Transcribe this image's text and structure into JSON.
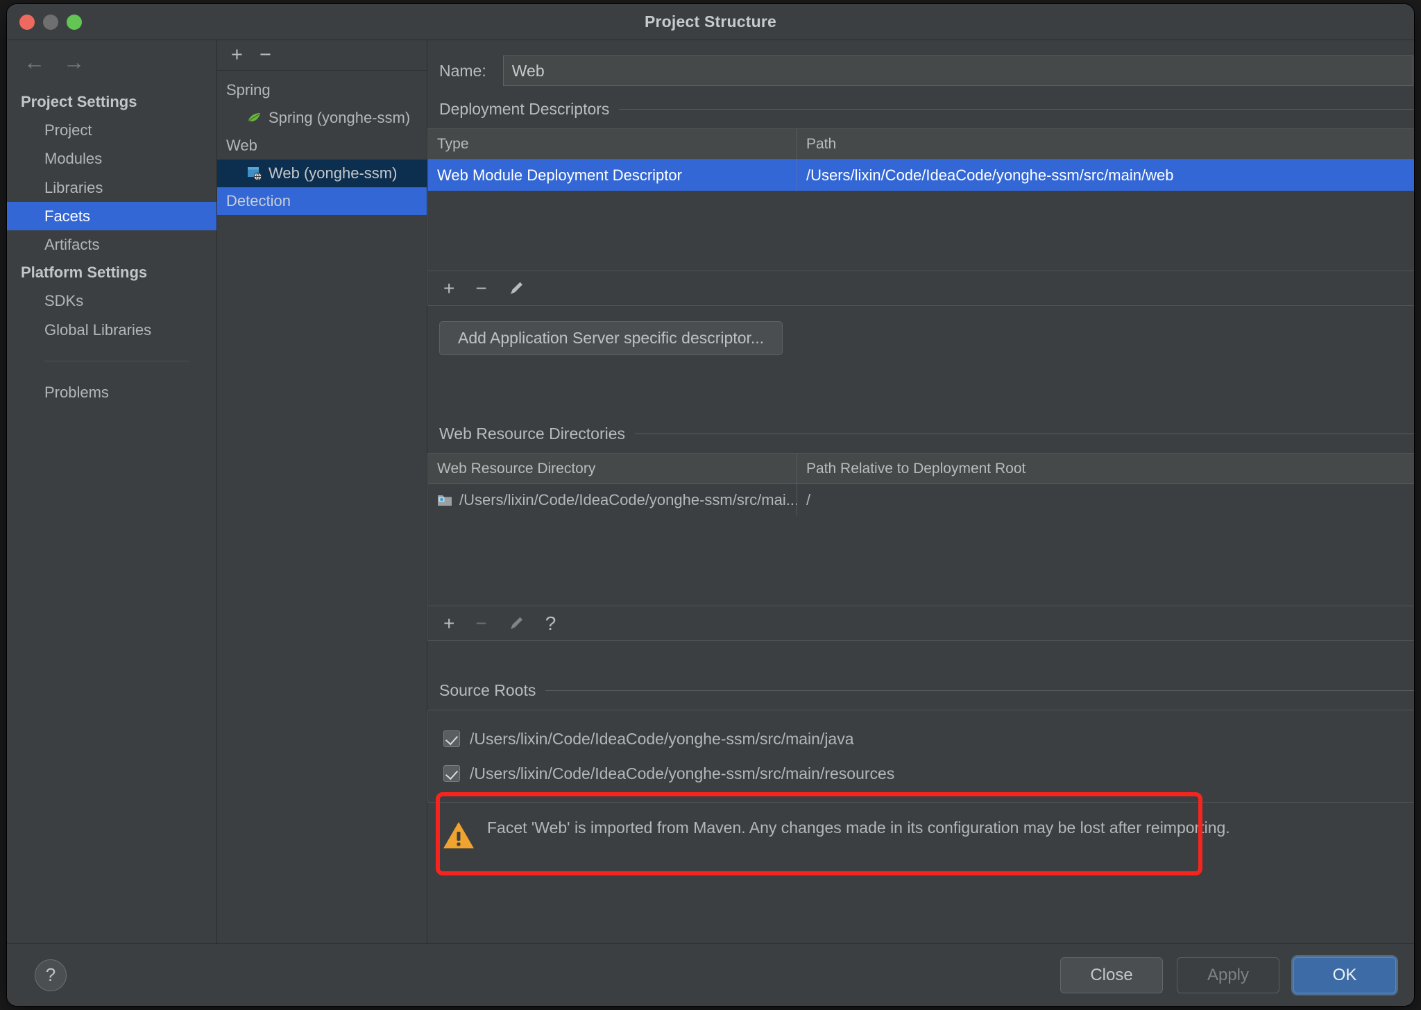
{
  "window": {
    "title": "Project Structure",
    "traffic_lights": [
      "close-red",
      "minimize-gray",
      "maximize-green"
    ]
  },
  "nav": {
    "back_icon": "←",
    "forward_icon": "→",
    "groups": [
      {
        "title": "Project Settings",
        "items": [
          {
            "label": "Project",
            "selected": false
          },
          {
            "label": "Modules",
            "selected": false
          },
          {
            "label": "Libraries",
            "selected": false
          },
          {
            "label": "Facets",
            "selected": true
          },
          {
            "label": "Artifacts",
            "selected": false
          }
        ]
      },
      {
        "title": "Platform Settings",
        "items": [
          {
            "label": "SDKs",
            "selected": false
          },
          {
            "label": "Global Libraries",
            "selected": false
          }
        ]
      }
    ],
    "problems_label": "Problems"
  },
  "tree": {
    "toolbar": {
      "add_icon": "+",
      "remove_icon": "−"
    },
    "rows": [
      {
        "label": "Spring",
        "kind": "group",
        "icon": null,
        "state": "none"
      },
      {
        "label": "Spring (yonghe-ssm)",
        "kind": "child",
        "icon": "spring-leaf-icon",
        "state": "none"
      },
      {
        "label": "Web",
        "kind": "group",
        "icon": null,
        "state": "none"
      },
      {
        "label": "Web (yonghe-ssm)",
        "kind": "child",
        "icon": "web-facet-icon",
        "state": "selected-inactive"
      },
      {
        "label": "Detection",
        "kind": "group",
        "icon": null,
        "state": "selected-active"
      }
    ]
  },
  "detail": {
    "name_label": "Name:",
    "name_value": "Web",
    "name_placeholder": "",
    "deployment": {
      "section_title": "Deployment Descriptors",
      "columns": [
        "Type",
        "Path"
      ],
      "rows": [
        {
          "type": "Web Module Deployment Descriptor",
          "path": "/Users/lixin/Code/IdeaCode/yonghe-ssm/src/main/web",
          "selected": true
        }
      ],
      "toolbar": {
        "add": "+",
        "remove": "−",
        "edit": "pencil-icon"
      },
      "add_server_descriptor_button": "Add Application Server specific descriptor..."
    },
    "web_resources": {
      "section_title": "Web Resource Directories",
      "columns": [
        "Web Resource Directory",
        "Path Relative to Deployment Root"
      ],
      "rows": [
        {
          "directory": "/Users/lixin/Code/IdeaCode/yonghe-ssm/src/mai...",
          "relative_path": "/",
          "icon": "folder-web-icon"
        }
      ],
      "toolbar": {
        "add": "+",
        "remove": "−",
        "edit": "pencil-icon",
        "help": "?"
      }
    },
    "source_roots": {
      "section_title": "Source Roots",
      "highlight_color": "#f5251d",
      "items": [
        {
          "label": "/Users/lixin/Code/IdeaCode/yonghe-ssm/src/main/java",
          "checked": true
        },
        {
          "label": "/Users/lixin/Code/IdeaCode/yonghe-ssm/src/main/resources",
          "checked": true
        }
      ]
    },
    "warning": {
      "icon": "warning-triangle-icon",
      "text": "Facet 'Web' is imported from Maven. Any changes made in its configuration may be lost after reimporting."
    }
  },
  "footer": {
    "help_icon": "?",
    "close_label": "Close",
    "apply_label": "Apply",
    "ok_label": "OK",
    "apply_enabled": false
  },
  "colors": {
    "accent_blue": "#3367d6",
    "selected_inactive": "#0d2f4f",
    "window_bg": "#3c3f41",
    "ok_button": "#3c6ba6",
    "highlight_red": "#f5251d",
    "warning_amber": "#f0a32e"
  }
}
